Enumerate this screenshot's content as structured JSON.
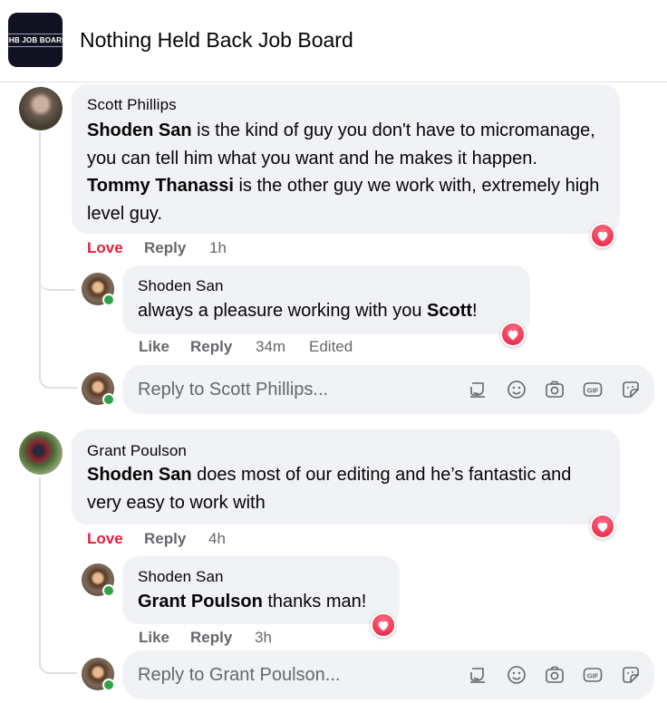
{
  "header": {
    "logo_text": "NHB JOB BOARD",
    "group_name": "Nothing Held Back Job Board"
  },
  "comments": [
    {
      "author": "Scott Phillips",
      "segments": [
        {
          "text": "Shoden San",
          "bold": true
        },
        {
          "text": " is the kind of guy you don't have to micromanage, you can tell him what you want and he makes it happen. ",
          "bold": false
        },
        {
          "text": "Tommy Thanassi",
          "bold": true
        },
        {
          "text": " is the other guy we work with, extremely high level guy.",
          "bold": false
        }
      ],
      "reaction": "heart",
      "actions": {
        "love": "Love",
        "reply": "Reply",
        "time": "1h"
      },
      "replies": [
        {
          "author": "Shoden San",
          "segments": [
            {
              "text": "always a pleasure working with you ",
              "bold": false
            },
            {
              "text": "Scott",
              "bold": true
            },
            {
              "text": "!",
              "bold": false
            }
          ],
          "reaction": "heart",
          "actions": {
            "like": "Like",
            "reply": "Reply",
            "time": "34m",
            "edited": "Edited"
          }
        }
      ],
      "reply_box": {
        "placeholder": "Reply to Scott Phillips..."
      }
    },
    {
      "author": "Grant Poulson",
      "segments": [
        {
          "text": "Shoden San",
          "bold": true
        },
        {
          "text": " does most of our editing and he’s fantastic and very easy to work with",
          "bold": false
        }
      ],
      "reaction": "heart",
      "actions": {
        "love": "Love",
        "reply": "Reply",
        "time": "4h"
      },
      "replies": [
        {
          "author": "Shoden San",
          "segments": [
            {
              "text": "Grant Poulson",
              "bold": true
            },
            {
              "text": " thanks man!",
              "bold": false
            }
          ],
          "reaction": "heart",
          "actions": {
            "like": "Like",
            "reply": "Reply",
            "time": "3h"
          }
        }
      ],
      "reply_box": {
        "placeholder": "Reply to Grant Poulson..."
      }
    }
  ],
  "composer_icons": [
    "avatar-sticker-icon",
    "emoji-icon",
    "camera-icon",
    "gif-icon",
    "sticker-icon"
  ],
  "colors": {
    "love": "#e41e3f",
    "bubble": "#f0f2f5",
    "secondary_text": "#65676b",
    "online": "#31a24c"
  }
}
